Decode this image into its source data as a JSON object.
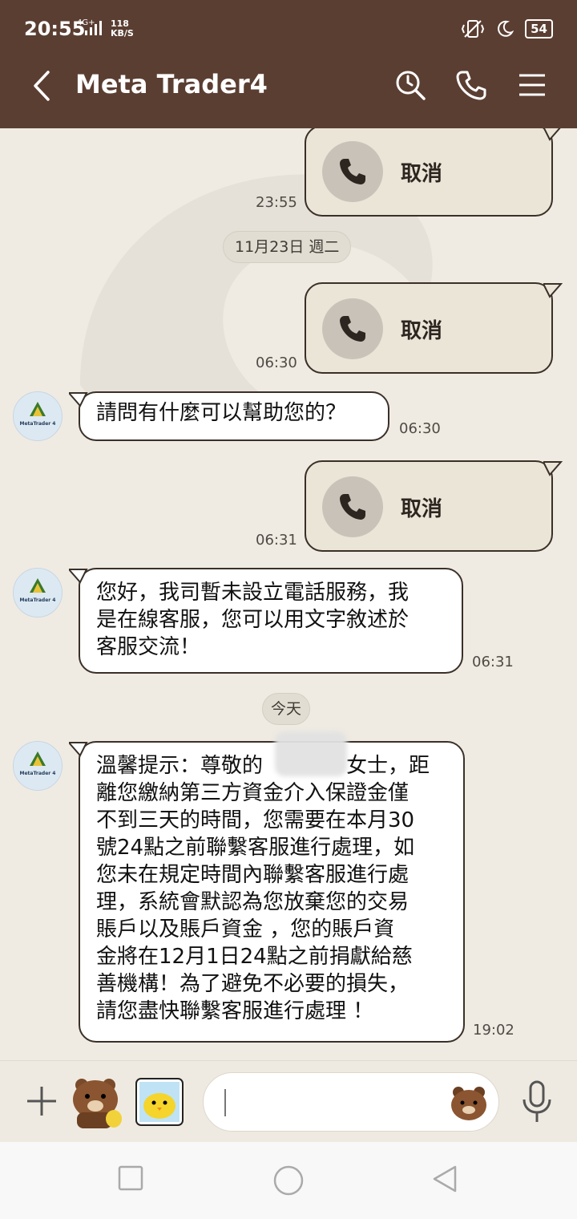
{
  "status_bar": {
    "time": "20:55",
    "network": "4G+",
    "speed_value": "118",
    "speed_unit": "KB/S",
    "battery": "54"
  },
  "header": {
    "title": "Meta Trader4"
  },
  "avatar_label": "MetaTrader 4",
  "messages": {
    "call1": {
      "label": "取消",
      "time": "23:55"
    },
    "date1": "11月23日 週二",
    "call2": {
      "label": "取消",
      "time": "06:30"
    },
    "msg1": {
      "text": "請問有什麼可以幫助您的？",
      "time": "06:30"
    },
    "call3": {
      "label": "取消",
      "time": "06:31"
    },
    "msg2": {
      "text": "您好，我司暫未設立電話服務，我\n是在線客服，您可以用文字敘述於\n客服交流！",
      "time": "06:31"
    },
    "date2": "今天",
    "msg3": {
      "text": "溫馨提示：尊敬的　　　　女士，距\n離您繳納第三方資金介入保證金僅\n不到三天的時間，您需要在本月30\n號24點之前聯繫客服進行處理，如\n您未在規定時間內聯繫客服進行處\n理，系統會默認為您放棄您的交易\n賬戶以及賬戶資金 ，您的賬戶資\n金將在12月1日24點之前捐獻給慈\n善機構！為了避免不必要的損失，\n請您盡快聯繫客服進行處理 ！",
      "time": "19:02"
    }
  },
  "colors": {
    "header": "#5b3e32",
    "chat_bg": "#efebe3",
    "bubble_border": "#3a3028"
  }
}
